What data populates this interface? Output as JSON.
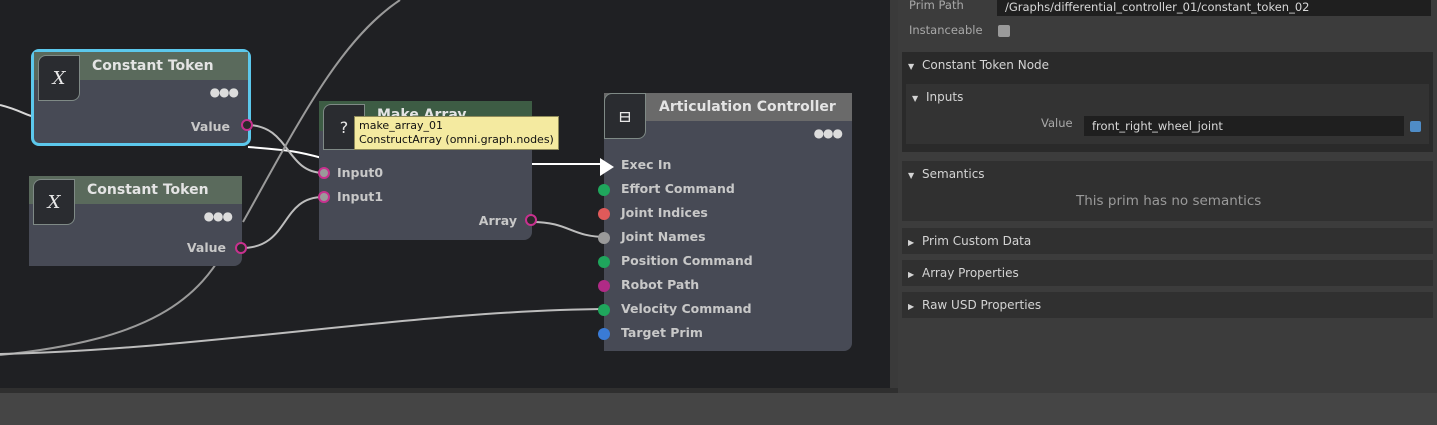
{
  "graph": {
    "node_const_1": {
      "title": "Constant Token",
      "icon": "X",
      "port_value": "Value"
    },
    "node_const_2": {
      "title": "Constant Token",
      "icon": "X",
      "port_value": "Value"
    },
    "node_make_array": {
      "title": "Make Array",
      "icon": "?",
      "inputs": [
        "Input0",
        "Input1"
      ],
      "output": "Array"
    },
    "tooltip": {
      "line1": "make_array_01",
      "line2": "ConstructArray (omni.graph.nodes)"
    },
    "node_articulation": {
      "title": "Articulation Controller",
      "inputs": [
        {
          "label": "Exec In",
          "color": "#ffffff"
        },
        {
          "label": "Effort Command",
          "color": "#1fa65c"
        },
        {
          "label": "Joint Indices",
          "color": "#e05a5a"
        },
        {
          "label": "Joint Names",
          "color": "#9a9a9a"
        },
        {
          "label": "Position Command",
          "color": "#1fa65c"
        },
        {
          "label": "Robot Path",
          "color": "#b02a86"
        },
        {
          "label": "Velocity Command",
          "color": "#1fa65c"
        },
        {
          "label": "Target Prim",
          "color": "#3a7bd5"
        }
      ]
    },
    "selected_border_color": "#5cc8ec"
  },
  "properties": {
    "prim_path_label": "Prim Path",
    "prim_path_value": "/Graphs/differential_controller_01/constant_token_02",
    "instanceable_label": "Instanceable",
    "section_node": "Constant Token Node",
    "subsection_inputs": "Inputs",
    "value_label": "Value",
    "value_field": "front_right_wheel_joint",
    "section_semantics": "Semantics",
    "semantics_note": "This prim has no semantics",
    "collapsed_sections": [
      "Prim Custom Data",
      "Array Properties",
      "Raw USD Properties"
    ]
  }
}
